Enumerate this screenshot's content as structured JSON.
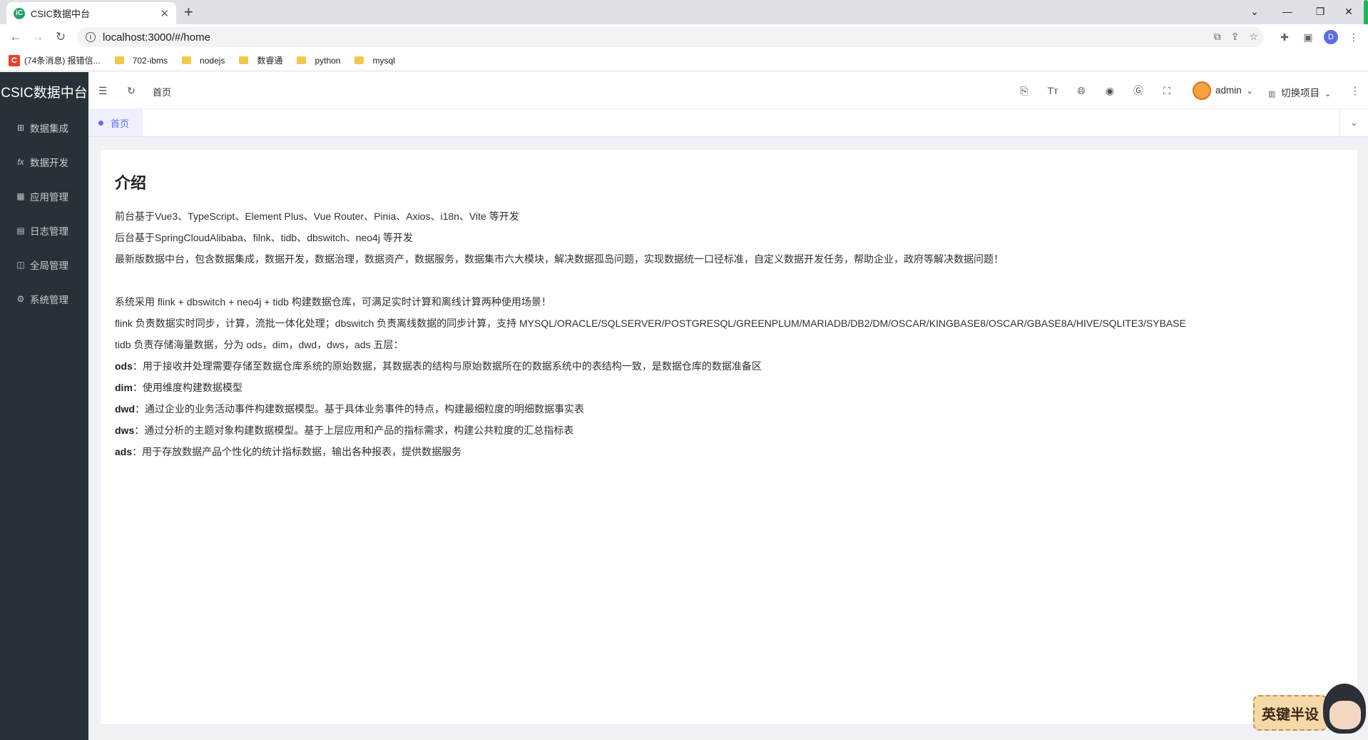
{
  "browser": {
    "tab_title": "CSIC数据中台",
    "tab_favicon": "iC",
    "url": "localhost:3000/#/home",
    "profile_initial": "D",
    "bookmarks": [
      {
        "label": "(74条消息) 报错信...",
        "icon": "csdn-icon"
      },
      {
        "label": "702-ibms",
        "icon": "folder-icon"
      },
      {
        "label": "nodejs",
        "icon": "folder-icon"
      },
      {
        "label": "数睿通",
        "icon": "folder-icon"
      },
      {
        "label": "python",
        "icon": "folder-icon"
      },
      {
        "label": "mysql",
        "icon": "folder-icon"
      }
    ]
  },
  "sidebar": {
    "logo": "CSIC数据中台",
    "items": [
      {
        "label": "数据集成",
        "icon": "grid-chart-icon"
      },
      {
        "label": "数据开发",
        "icon": "function-icon"
      },
      {
        "label": "应用管理",
        "icon": "apps-icon"
      },
      {
        "label": "日志管理",
        "icon": "log-icon"
      },
      {
        "label": "全局管理",
        "icon": "global-icon"
      },
      {
        "label": "系统管理",
        "icon": "gear-icon"
      }
    ]
  },
  "header": {
    "breadcrumb": "首页",
    "user": "admin",
    "project": "切换项目"
  },
  "tags": {
    "active": "首页"
  },
  "content": {
    "title": "介绍",
    "line1": "前台基于Vue3、TypeScript、Element Plus、Vue Router、Pinia、Axios、i18n、Vite 等开发",
    "line2": "后台基于SpringCloudAlibaba、filnk、tidb、dbswitch、neo4j 等开发",
    "line3": "最新版数据中台，包含数据集成，数据开发，数据治理，数据资产，数据服务，数据集市六大模块，解决数据孤岛问题，实现数据统一口径标准，自定义数据开发任务，帮助企业，政府等解决数据问题！",
    "line4": "系统采用 flink + dbswitch + neo4j + tidb 构建数据仓库，可满足实时计算和离线计算两种使用场景！",
    "line5": "flink 负责数据实时同步，计算，流批一体化处理；dbswitch 负责离线数据的同步计算，支持 MYSQL/ORACLE/SQLSERVER/POSTGRESQL/GREENPLUM/MARIADB/DB2/DM/OSCAR/KINGBASE8/OSCAR/GBASE8A/HIVE/SQLITE3/SYBASE",
    "line6": "tidb 负责存储海量数据，分为 ods，dim，dwd，dws，ads 五层：",
    "layers": [
      {
        "name": "ods",
        "desc": "：用于接收并处理需要存储至数据仓库系统的原始数据，其数据表的结构与原始数据所在的数据系统中的表结构一致，是数据仓库的数据准备区"
      },
      {
        "name": "dim",
        "desc": "：使用维度构建数据模型"
      },
      {
        "name": "dwd",
        "desc": "：通过企业的业务活动事件构建数据模型。基于具体业务事件的特点，构建最细粒度的明细数据事实表"
      },
      {
        "name": "dws",
        "desc": "：通过分析的主题对象构建数据模型。基于上层应用和产品的指标需求，构建公共粒度的汇总指标表"
      },
      {
        "name": "ads",
        "desc": "：用于存放数据产品个性化的统计指标数据，输出各种报表，提供数据服务"
      }
    ]
  },
  "mascot": {
    "sign_text": "英键半设"
  },
  "colors": {
    "sidebar_bg": "#263238",
    "accent": "#5b6ee1",
    "content_bg": "#f0f2f5"
  }
}
